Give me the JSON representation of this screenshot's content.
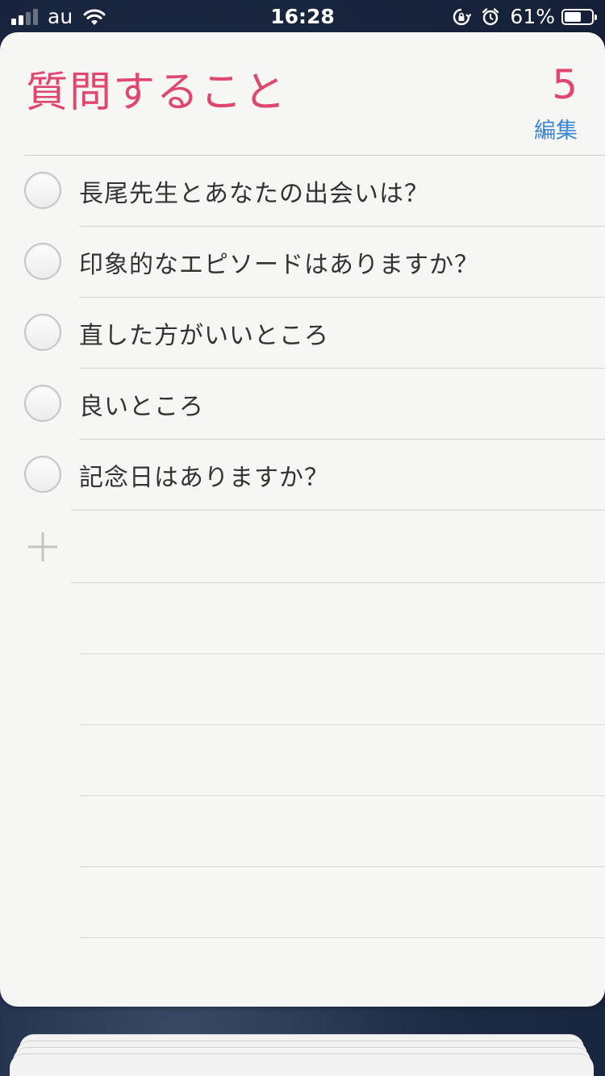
{
  "status_bar": {
    "carrier": "au",
    "time": "16:28",
    "battery_percent": "61%",
    "battery_level": 0.61,
    "signal_bars_active": 2,
    "signal_bars_total": 4,
    "icons": [
      "wifi-icon",
      "rotation-lock-icon",
      "alarm-icon",
      "battery-icon"
    ]
  },
  "list": {
    "title": "質問すること",
    "count": "5",
    "edit_label": "編集",
    "accent_color": "#e0476e",
    "link_color": "#3a86d6",
    "items": [
      {
        "text": "長尾先生とあなたの出会いは？",
        "completed": false
      },
      {
        "text": "印象的なエピソードはありますか？",
        "completed": false
      },
      {
        "text": "直した方がいいところ",
        "completed": false
      },
      {
        "text": "良いところ",
        "completed": false
      },
      {
        "text": "記念日はありますか？",
        "completed": false
      }
    ],
    "add_icon": "plus-icon"
  }
}
